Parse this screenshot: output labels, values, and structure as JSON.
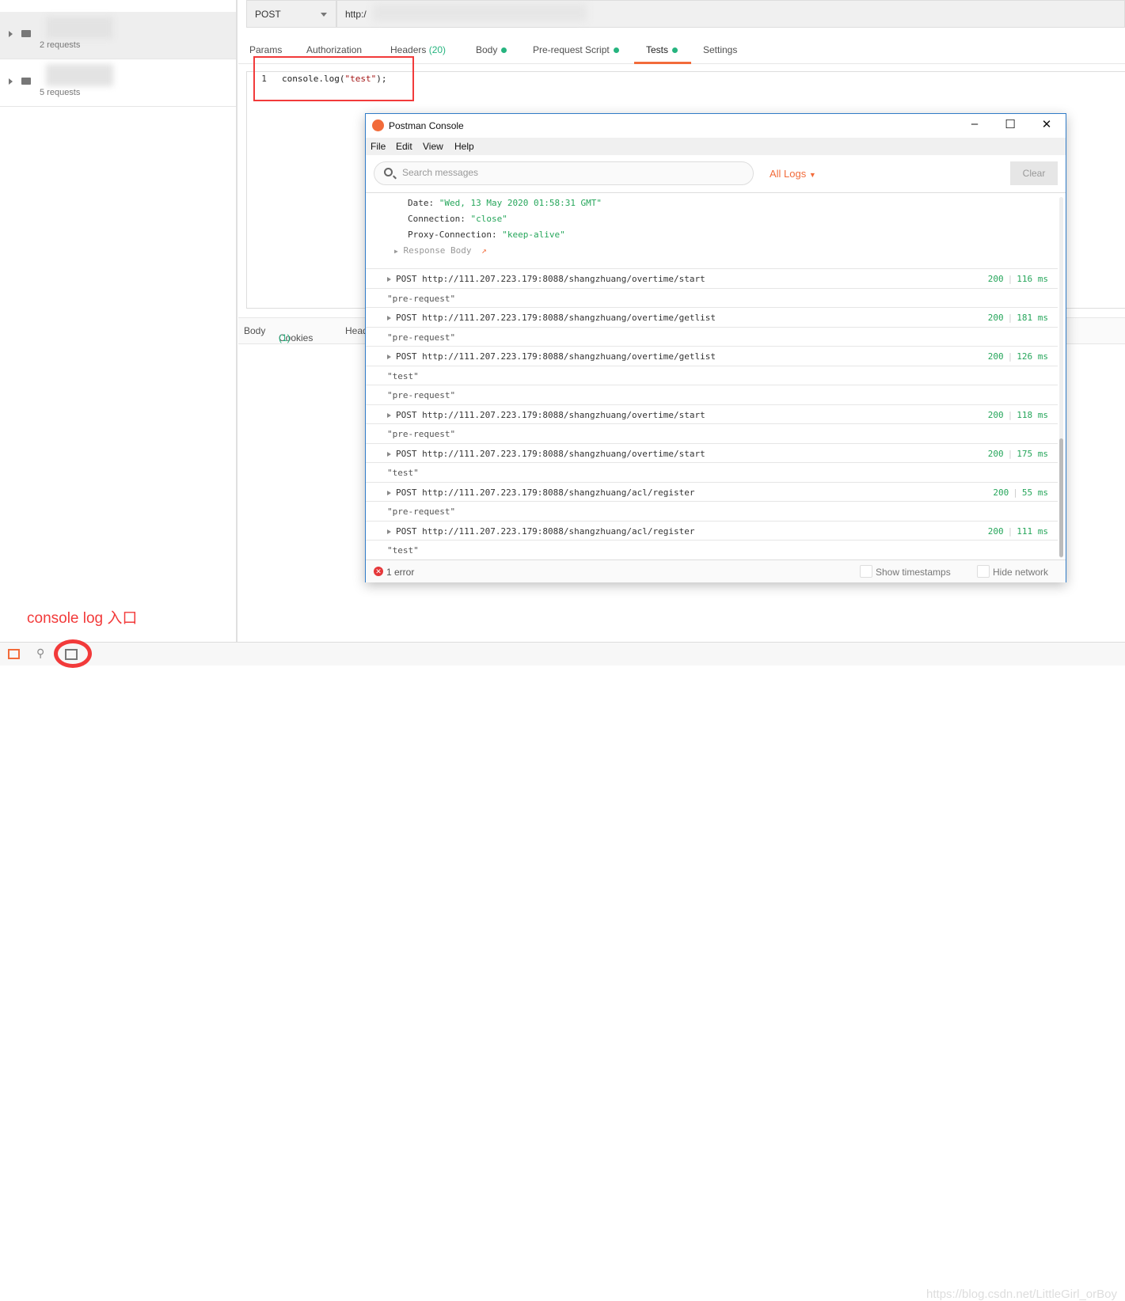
{
  "sidebar": {
    "collections": [
      {
        "count": "2 requests"
      },
      {
        "count": "5 requests"
      }
    ]
  },
  "request": {
    "method": "POST",
    "url": "http:/"
  },
  "tabs": [
    {
      "label": "Params"
    },
    {
      "label": "Authorization"
    },
    {
      "label": "Headers",
      "badge": "(20)"
    },
    {
      "label": "Body"
    },
    {
      "label": "Pre-request Script"
    },
    {
      "label": "Tests",
      "active": true
    },
    {
      "label": "Settings"
    }
  ],
  "editor": {
    "line": "1",
    "code_pre": "console.log(",
    "code_str": "\"test\"",
    "code_post": ");"
  },
  "response_tabs": [
    {
      "label": "Body"
    },
    {
      "label": "Cookies",
      "badge": "(1)"
    },
    {
      "label": "Head"
    }
  ],
  "console": {
    "title": "Postman Console",
    "menu": [
      "File",
      "Edit",
      "View",
      "Help"
    ],
    "search_placeholder": "Search messages",
    "filter": "All Logs",
    "clear": "Clear",
    "headers": [
      {
        "key": "Date: ",
        "value": "\"Wed, 13 May 2020 01:58:31 GMT\""
      },
      {
        "key": "Connection: ",
        "value": "\"close\""
      },
      {
        "key": "Proxy-Connection: ",
        "value": "\"keep-alive\""
      }
    ],
    "response_body": "Response Body",
    "entries": [
      {
        "type": "req",
        "text": "POST http://111.207.223.179:8088/shangzhuang/overtime/start",
        "status": "200",
        "time": "116 ms"
      },
      {
        "type": "log",
        "text": "\"pre-request\""
      },
      {
        "type": "req",
        "text": "POST http://111.207.223.179:8088/shangzhuang/overtime/getlist",
        "status": "200",
        "time": "181 ms"
      },
      {
        "type": "log",
        "text": "\"pre-request\""
      },
      {
        "type": "req",
        "text": "POST http://111.207.223.179:8088/shangzhuang/overtime/getlist",
        "status": "200",
        "time": "126 ms"
      },
      {
        "type": "log",
        "text": "\"test\""
      },
      {
        "type": "log",
        "text": "\"pre-request\""
      },
      {
        "type": "req",
        "text": "POST http://111.207.223.179:8088/shangzhuang/overtime/start",
        "status": "200",
        "time": "118 ms"
      },
      {
        "type": "log",
        "text": "\"pre-request\""
      },
      {
        "type": "req",
        "text": "POST http://111.207.223.179:8088/shangzhuang/overtime/start",
        "status": "200",
        "time": "175 ms"
      },
      {
        "type": "log",
        "text": "\"test\""
      },
      {
        "type": "req",
        "text": "POST http://111.207.223.179:8088/shangzhuang/acl/register",
        "status": "200",
        "time": "55 ms"
      },
      {
        "type": "log",
        "text": "\"pre-request\""
      },
      {
        "type": "req",
        "text": "POST http://111.207.223.179:8088/shangzhuang/acl/register",
        "status": "200",
        "time": "111 ms"
      },
      {
        "type": "log",
        "text": "\"test\""
      }
    ],
    "errors": "1 error",
    "show_timestamps": "Show timestamps",
    "hide_network": "Hide network"
  },
  "annotation": "console log 入口",
  "watermark": "https://blog.csdn.net/LittleGirl_orBoy",
  "colors": {
    "accent": "#f26b3a",
    "success": "#26a65b",
    "annotation": "#f23a3a"
  }
}
